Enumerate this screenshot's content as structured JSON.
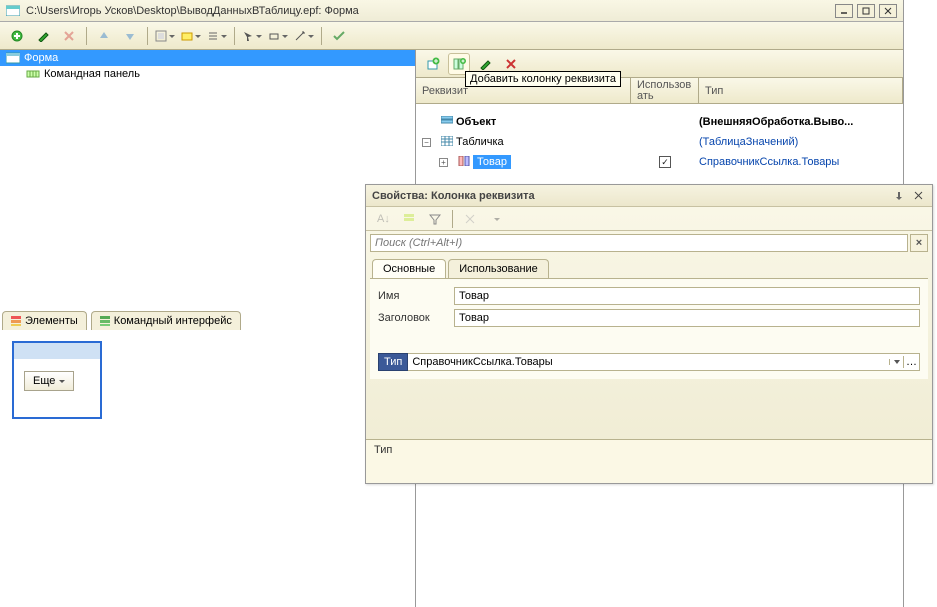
{
  "window": {
    "title": "C:\\Users\\Игорь Усков\\Desktop\\ВыводДанныхВТаблицу.epf: Форма"
  },
  "tree": {
    "form": "Форма",
    "cmd": "Командная панель"
  },
  "bottomTabs": {
    "elements": "Элементы",
    "cmdIface": "Командный интерфейс"
  },
  "preview": {
    "more": "Еще"
  },
  "gridHeader": {
    "col1": "Реквизит",
    "col2": "Использовать",
    "col3": "Тип"
  },
  "tooltip": "Добавить колонку реквизита",
  "gridRows": {
    "r1": {
      "name": "Объект",
      "type": "(ВнешняяОбработка.Выво..."
    },
    "r2": {
      "name": "Табличка",
      "type": "(ТаблицаЗначений)"
    },
    "r3": {
      "name": "Товар",
      "type": "СправочникСсылка.Товары"
    }
  },
  "props": {
    "title": "Свойства: Колонка реквизита",
    "searchPlaceholder": "Поиск (Ctrl+Alt+I)",
    "tabs": {
      "main": "Основные",
      "use": "Использование"
    },
    "rows": {
      "nameLabel": "Имя",
      "nameValue": "Товар",
      "titleLabel": "Заголовок",
      "titleValue": "Товар",
      "typeLabel": "Тип",
      "typeValue": "СправочникСсылка.Товары"
    },
    "status": "Тип"
  }
}
